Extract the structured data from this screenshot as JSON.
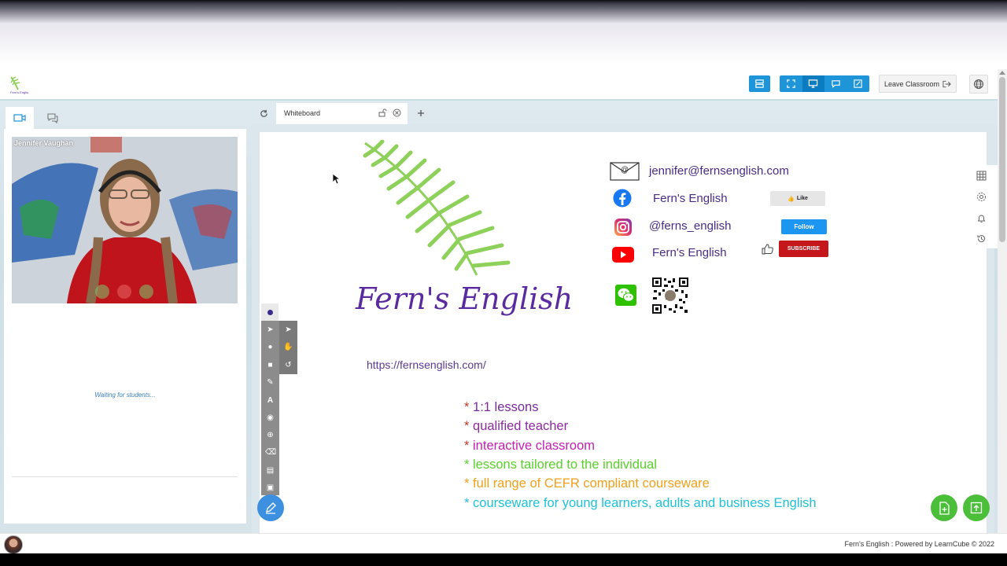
{
  "header": {
    "leave_label": "Leave Classroom"
  },
  "left_panel": {
    "participant_name": "Jennifer Vaughan",
    "waiting_text": "Waiting for students..."
  },
  "tabs": {
    "active_label": "Whiteboard"
  },
  "whiteboard": {
    "brand_text": "Fern's English",
    "url": "https://fernsenglish.com/",
    "email": "jennifer@fernsenglish.com",
    "facebook": "Fern's English",
    "instagram": "@ferns_english",
    "youtube": "Fern's English",
    "like_label": "Like",
    "follow_label": "Follow",
    "subscribe_label": "SUBSCRIBE",
    "bullets": [
      {
        "text": "1:1 lessons",
        "color": "#7a2a9e"
      },
      {
        "text": "qualified teacher",
        "color": "#8e2aa0"
      },
      {
        "text": "interactive classroom",
        "color": "#c61fb3"
      },
      {
        "text": "lessons tailored to the individual",
        "color": "#58d12a"
      },
      {
        "text": "full range of CEFR compliant courseware",
        "color": "#f0a01c"
      },
      {
        "text": "courseware for young learners, adults and business English",
        "color": "#1fc1d8"
      }
    ],
    "bullet_marker": "*"
  },
  "footer": {
    "text": "Fern's English : Powered by  LearnCube © 2022"
  },
  "colors": {
    "primary_blue": "#1e95d9",
    "fab_green": "#4bbf3a",
    "fern_green": "#8ed15a",
    "brand_purple": "#5a2aa0"
  }
}
